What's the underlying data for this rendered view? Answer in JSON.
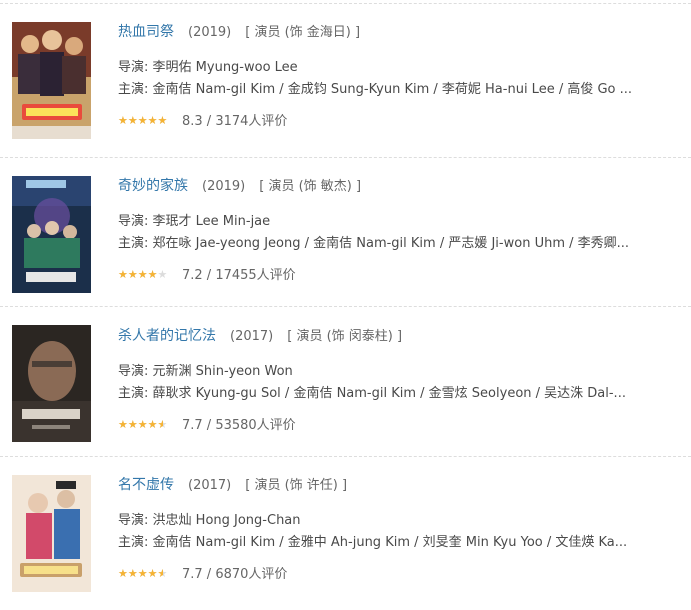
{
  "movies": [
    {
      "title": "热血司祭",
      "year": "(2019)",
      "role": "[ 演员 (饰 金海日) ]",
      "director_label": "导演:",
      "director": "李明佑 Myung-woo Lee",
      "cast_label": "主演:",
      "cast": "金南佶 Nam-gil Kim / 金成钧 Sung-Kyun Kim / 李荷妮 Ha-nui Lee / 高俊 Go ...",
      "rating": 8.3,
      "rating_text": "8.3 / 3174人评价",
      "stars_fraction": 0.9,
      "poster_colors": [
        "#7a3b2a",
        "#c9a36b",
        "#3a2d3b",
        "#e94b3c"
      ]
    },
    {
      "title": "奇妙的家族",
      "year": "(2019)",
      "role": "[ 演员 (饰 敏杰) ]",
      "director_label": "导演:",
      "director": "李珉才 Lee Min-jae",
      "cast_label": "主演:",
      "cast": "郑在咏 Jae-yeong Jeong / 金南佶 Nam-gil Kim / 严志媛 Ji-won Uhm / 李秀卿...",
      "rating": 7.2,
      "rating_text": "7.2 / 17455人评价",
      "stars_fraction": 0.7,
      "poster_colors": [
        "#1b2f4a",
        "#6b4fa0",
        "#2e7a5e",
        "#e6e6e6"
      ]
    },
    {
      "title": "杀人者的记忆法",
      "year": "(2017)",
      "role": "[ 演员 (饰 闵泰柱) ]",
      "director_label": "导演:",
      "director": "元新渊 Shin-yeon Won",
      "cast_label": "主演:",
      "cast": "薛耿求 Kyung-gu Sol / 金南佶 Nam-gil Kim / 金雪炫 Seolyeon / 吴达洙 Dal-...",
      "rating": 7.7,
      "rating_text": "7.7 / 53580人评价",
      "stars_fraction": 0.8,
      "poster_colors": [
        "#2b2622",
        "#8a6a55",
        "#4a3e36",
        "#d9d2c8"
      ]
    },
    {
      "title": "名不虚传",
      "year": "(2017)",
      "role": "[ 演员 (饰 许任) ]",
      "director_label": "导演:",
      "director": "洪忠灿 Hong Jong-Chan",
      "cast_label": "主演:",
      "cast": "金南佶 Nam-gil Kim / 金雅中 Ah-jung Kim / 刘旻奎 Min Kyu Yoo / 文佳煐 Ka...",
      "rating": 7.7,
      "rating_text": "7.7 / 6870人评价",
      "stars_fraction": 0.8,
      "poster_colors": [
        "#f2e6d8",
        "#d24a6a",
        "#3a6fb0",
        "#c9a06a"
      ]
    }
  ],
  "stars_glyph": "★★★★★"
}
